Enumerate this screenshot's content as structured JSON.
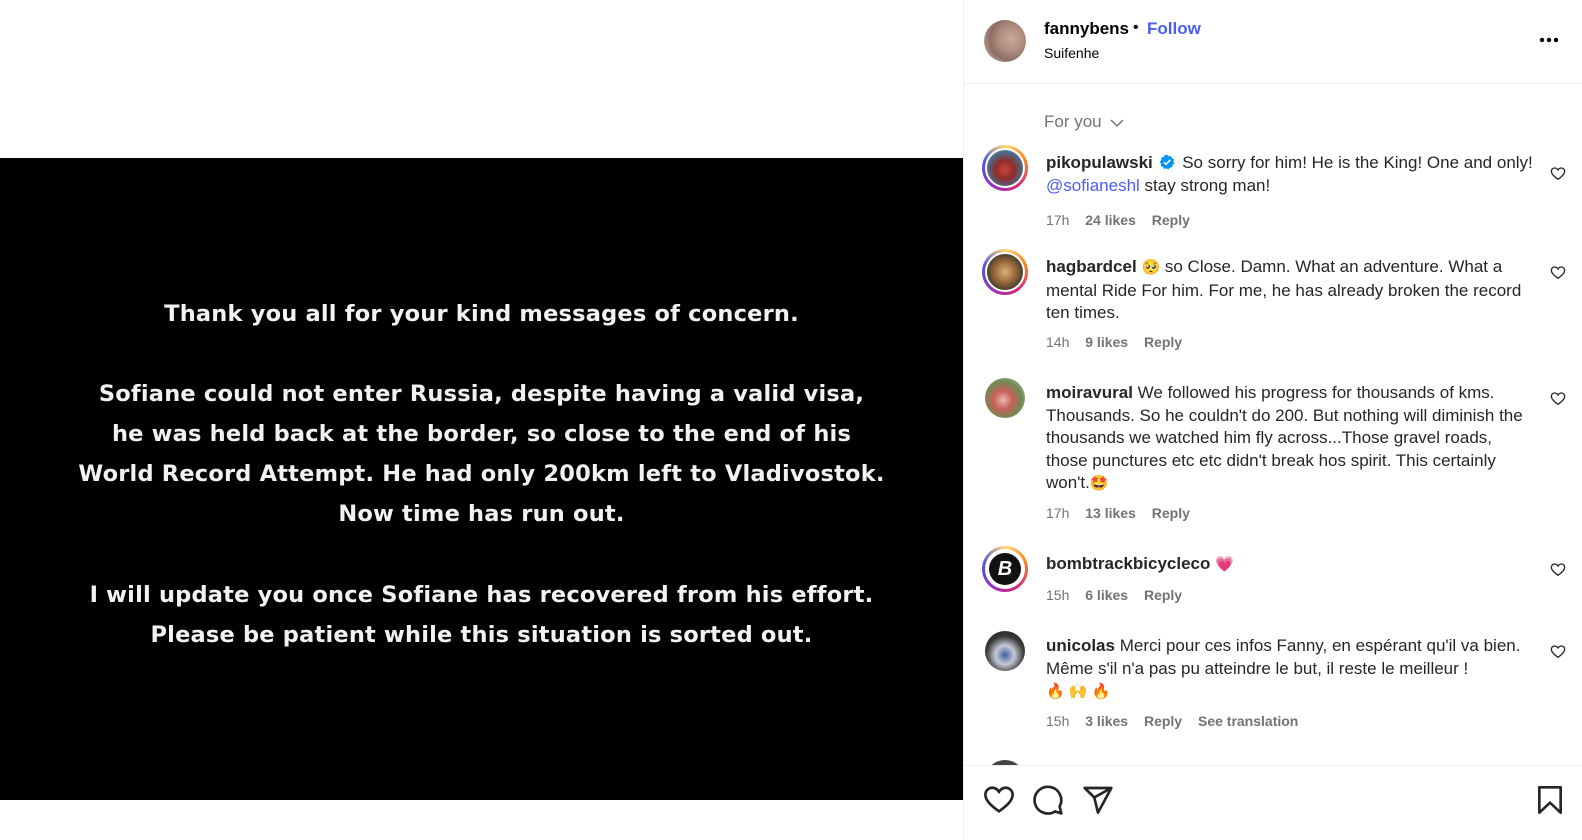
{
  "post_image": {
    "lines": [
      "Thank you all for your kind messages of concern.",
      "Sofiane could not enter Russia, despite having a valid visa,",
      "he was held back at the border, so close to the end of his",
      "World Record Attempt. He had only 200km left to Vladivostok.",
      "Now time has run out.",
      "I will update you once Sofiane has recovered from his effort.",
      "Please be patient while this situation is sorted out."
    ]
  },
  "header": {
    "username": "fannybens",
    "separator": "•",
    "follow_label": "Follow",
    "subtitle": "Suifenhe",
    "more_icon": "more-horizontal-icon"
  },
  "sort": {
    "label": "For you",
    "icon": "chevron-down-icon"
  },
  "comments": [
    {
      "username": "pikopulawski",
      "verified": true,
      "text_before": "So sorry for him! He is the King! One and only!",
      "mention": "@sofianeshl",
      "text_after": "stay strong man!",
      "time": "17h",
      "likes": "24 likes",
      "reply": "Reply"
    },
    {
      "username": "hagbardcel",
      "emoji": "🥺",
      "text": "so Close. Damn. What an adventure. What a mental Ride For him. For me, he has already broken the record ten times.",
      "time": "14h",
      "likes": "9 likes",
      "reply": "Reply"
    },
    {
      "username": "moiravural",
      "text": "We followed his progress for thousands of kms. Thousands. So he couldn't do 200. But nothing will diminish the thousands we watched him fly across...Those gravel roads, those punctures etc etc didn't break hos spirit. This certainly won't.",
      "emoji_end": "🤩",
      "time": "17h",
      "likes": "13 likes",
      "reply": "Reply"
    },
    {
      "username": "bombtrackbicycleco",
      "emoji": "💗",
      "avatar_letter": "B",
      "time": "15h",
      "likes": "6 likes",
      "reply": "Reply"
    },
    {
      "username": "unicolas",
      "text": "Merci pour ces infos Fanny, en espérant qu'il va bien. Même s'il n'a pas pu atteindre le but, il reste le meilleur !",
      "emoji_end": "🔥 🙌 🔥",
      "time": "15h",
      "likes": "3 likes",
      "reply": "Reply",
      "see_translation": "See translation"
    }
  ],
  "actions": {
    "like_icon": "heart-icon",
    "comment_icon": "comment-icon",
    "share_icon": "send-icon",
    "save_icon": "bookmark-icon"
  },
  "colors": {
    "link_blue": "#4a5df9",
    "verified_blue": "#0095f6",
    "muted": "#737373",
    "text": "#262626"
  }
}
